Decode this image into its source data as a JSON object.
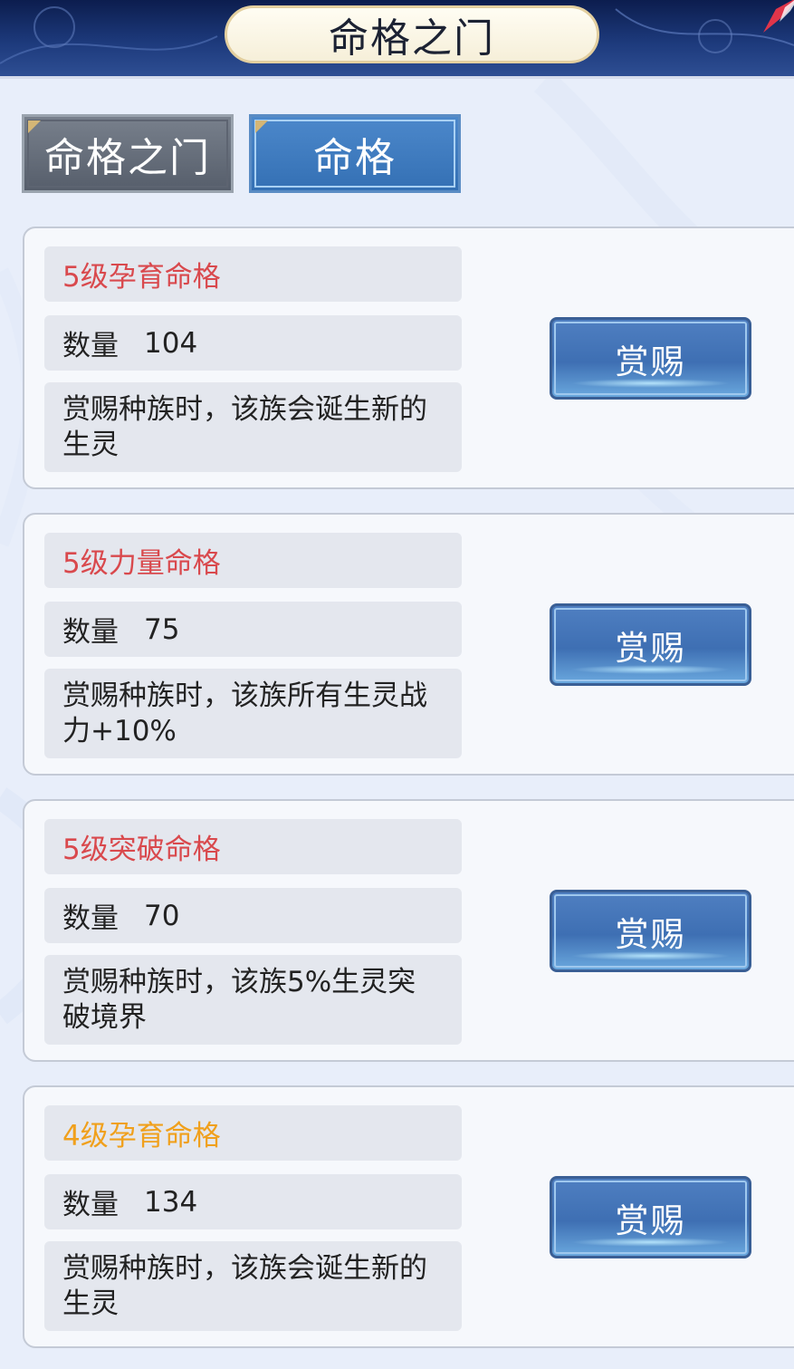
{
  "header": {
    "title": "命格之门"
  },
  "tabs": [
    {
      "label": "命格之门",
      "active": false
    },
    {
      "label": "命格",
      "active": true
    }
  ],
  "colors": {
    "level5": "#d9494d",
    "level4": "#f0a01c"
  },
  "cards": [
    {
      "name": "5级孕育命格",
      "name_color": "#d9494d",
      "qty_label": "数量",
      "qty": "104",
      "desc": "赏赐种族时，该族会诞生新的生灵",
      "button": "赏赐"
    },
    {
      "name": "5级力量命格",
      "name_color": "#d9494d",
      "qty_label": "数量",
      "qty": "75",
      "desc": "赏赐种族时，该族所有生灵战力+10%",
      "button": "赏赐"
    },
    {
      "name": "5级突破命格",
      "name_color": "#d9494d",
      "qty_label": "数量",
      "qty": "70",
      "desc": "赏赐种族时，该族5%生灵突破境界",
      "button": "赏赐"
    },
    {
      "name": "4级孕育命格",
      "name_color": "#f0a01c",
      "qty_label": "数量",
      "qty": "134",
      "desc": "赏赐种族时，该族会诞生新的生灵",
      "button": "赏赐"
    }
  ]
}
